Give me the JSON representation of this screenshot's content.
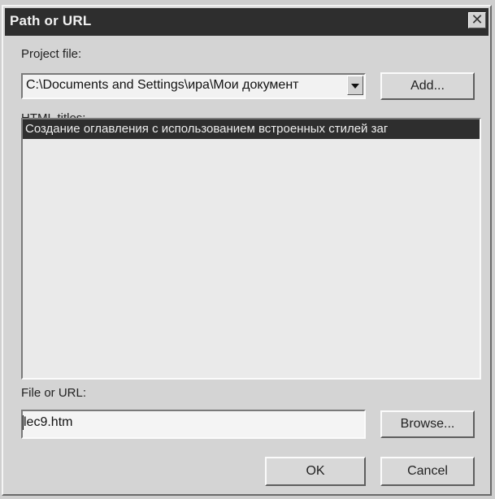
{
  "window": {
    "title": "Path or URL",
    "close_symbol": "✕"
  },
  "project": {
    "label": "Project file:",
    "value": "C:\\Documents and Settings\\ира\\Мои документ",
    "add_label": "Add..."
  },
  "titles": {
    "label": "HTML titles:",
    "items": [
      "Создание оглавления с использованием встроенных стилей заг"
    ]
  },
  "file": {
    "label": "File or URL:",
    "value": "lec9.htm",
    "browse_label": "Browse..."
  },
  "buttons": {
    "ok_label": "OK",
    "cancel_label": "Cancel"
  },
  "icons": {
    "close": "close-icon",
    "dropdown": "chevron-down-icon"
  }
}
